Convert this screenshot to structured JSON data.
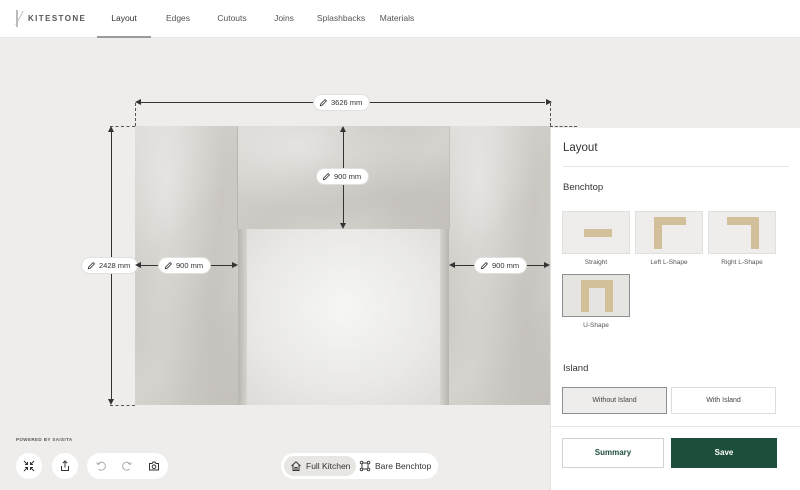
{
  "brand": {
    "name": "KITESTONE"
  },
  "nav": {
    "tabs": [
      {
        "label": "Layout",
        "active": true
      },
      {
        "label": "Edges"
      },
      {
        "label": "Cutouts"
      },
      {
        "label": "Joins"
      },
      {
        "label": "Splashbacks"
      },
      {
        "label": "Materials"
      }
    ]
  },
  "canvas": {
    "overall_width": "3626 mm",
    "overall_height": "2428 mm",
    "top_depth": "900 mm",
    "left_depth": "900 mm",
    "right_depth": "900 mm"
  },
  "panel": {
    "title": "Layout",
    "benchtop": {
      "title": "Benchtop",
      "shapes": [
        {
          "label": "Straight"
        },
        {
          "label": "Left L-Shape"
        },
        {
          "label": "Right L-Shape"
        },
        {
          "label": "U-Shape",
          "selected": true
        }
      ]
    },
    "island": {
      "title": "Island",
      "options": [
        {
          "label": "Without Island",
          "selected": true
        },
        {
          "label": "With Island"
        }
      ]
    },
    "summary_label": "Summary",
    "save_label": "Save"
  },
  "footer": {
    "powered_by": "POWERED BY SAISITA",
    "views": [
      {
        "label": "Full Kitchen",
        "active": true,
        "icon": "home-icon"
      },
      {
        "label": "Bare Benchtop",
        "icon": "benchtop-frame-icon"
      }
    ]
  },
  "colors": {
    "accent": "#1d4e3b",
    "tan": "#d4bf9b",
    "background": "#efedeb"
  }
}
